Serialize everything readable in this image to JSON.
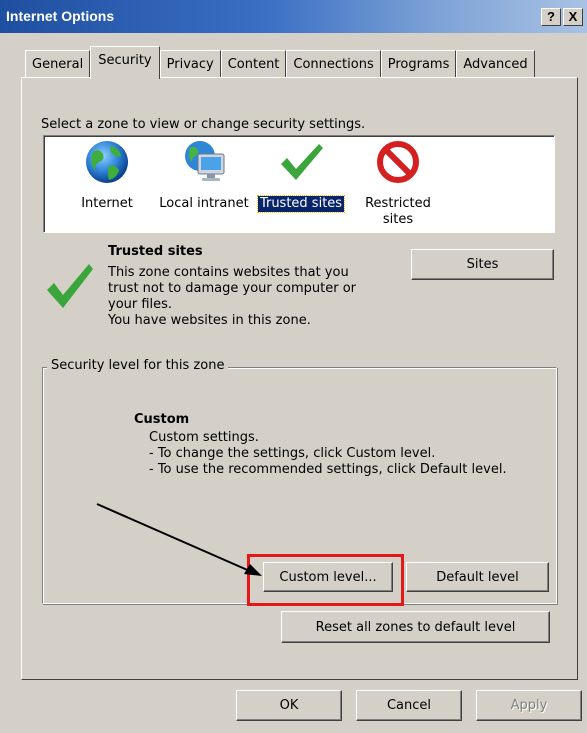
{
  "window": {
    "title": "Internet Options",
    "help_button": "?",
    "close_button": "X"
  },
  "tabs": [
    {
      "label": "General",
      "active": false
    },
    {
      "label": "Security",
      "active": true
    },
    {
      "label": "Privacy",
      "active": false
    },
    {
      "label": "Content",
      "active": false
    },
    {
      "label": "Connections",
      "active": false
    },
    {
      "label": "Programs",
      "active": false
    },
    {
      "label": "Advanced",
      "active": false
    }
  ],
  "security": {
    "select_zone_label": "Select a zone to view or change security settings.",
    "zones": [
      {
        "label": "Internet",
        "icon": "globe-icon",
        "selected": false
      },
      {
        "label": "Local intranet",
        "icon": "intranet-icon",
        "selected": false
      },
      {
        "label": "Trusted sites",
        "icon": "checkmark-icon",
        "selected": true
      },
      {
        "label": "Restricted\nsites",
        "icon": "restricted-icon",
        "selected": false
      }
    ],
    "zone_title": "Trusted sites",
    "zone_description": "This zone contains websites that you\ntrust not to damage your computer or\nyour files.\nYou have websites in this zone.",
    "sites_button": "Sites",
    "security_level_legend": "Security level for this zone",
    "level_title": "Custom",
    "level_description": "Custom settings.\n  - To change the settings, click Custom level.\n  - To use the recommended settings, click Default level.",
    "custom_level_button": "Custom level...",
    "default_level_button": "Default level",
    "reset_all_button": "Reset all zones to default level"
  },
  "footer": {
    "ok_button": "OK",
    "cancel_button": "Cancel",
    "apply_button": "Apply",
    "apply_enabled": false
  },
  "colors": {
    "title_bar_start": "#1f4fa0",
    "selection": "#0a246a",
    "highlight_box": "#e41818",
    "checkmark": "#3aa53a",
    "restricted": "#d42020"
  }
}
